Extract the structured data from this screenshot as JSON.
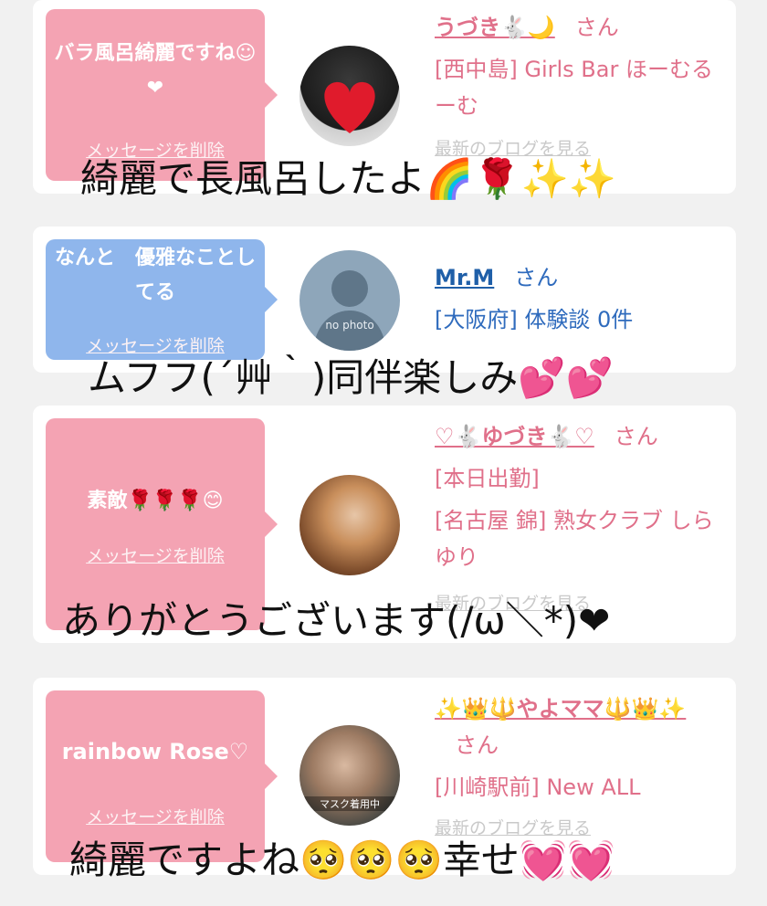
{
  "items": [
    {
      "message": "バラ風呂綺麗ですね☺❤",
      "delete_label": "メッセージを削除",
      "name": "うづき🐇🌙",
      "san": "さん",
      "details": [
        "[西中島] Girls Bar ほーむるーむ"
      ],
      "blog_link": "最新のブログを見る",
      "overlay_text": "綺麗で長風呂したよ🌈🌹✨✨"
    },
    {
      "message": "なんと　優雅なことしてる",
      "delete_label": "メッセージを削除",
      "name": "Mr.M",
      "san": "さん",
      "details": [
        "[大阪府] 体験談 0件"
      ],
      "avatar_caption": "no photo",
      "overlay_text": "ムフフ(´艸｀)同伴楽しみ💕💕"
    },
    {
      "message": "素敵🌹🌹🌹😊",
      "delete_label": "メッセージを削除",
      "name": "♡🐇ゆづき🐇♡",
      "san": "さん",
      "details": [
        "[本日出勤]",
        "[名古屋 錦] 熟女クラブ しらゆり"
      ],
      "blog_link": "最新のブログを見る",
      "overlay_text": "ありがとうございます(/ω＼*)❤"
    },
    {
      "message": "rainbow Rose♡",
      "delete_label": "メッセージを削除",
      "name": "✨👑🔱やよママ🔱👑✨",
      "san": "さん",
      "details": [
        "[川崎駅前] New ALL"
      ],
      "avatar_caption": "マスク着用中",
      "blog_link": "最新のブログを見る",
      "overlay_text": "綺麗ですよね🥺🥺🥺幸せ💓💓"
    }
  ],
  "colors": {
    "pink_bubble": "#f4a3b3",
    "blue_bubble": "#8fb6ec",
    "pink_text": "#e0708a",
    "blue_text": "#1f5fa8"
  }
}
